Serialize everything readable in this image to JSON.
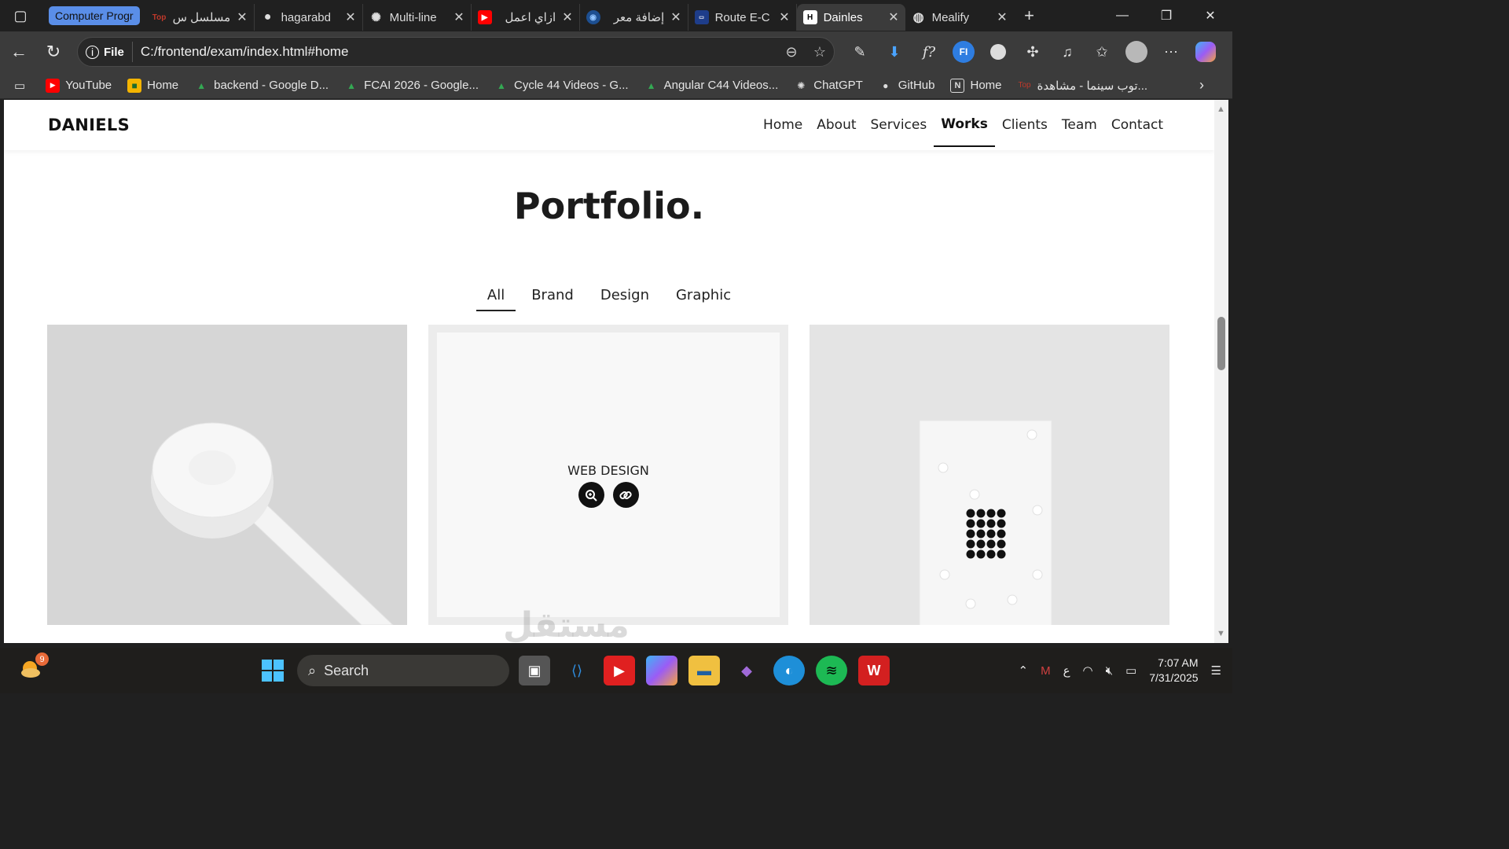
{
  "browser": {
    "tab_group_label": "Computer Progr",
    "tabs": [
      {
        "label": "مسلسل س",
        "favicon": "top-cinema-icon",
        "active": false
      },
      {
        "label": "hagarabd",
        "favicon": "github-icon",
        "active": false
      },
      {
        "label": "Multi-line",
        "favicon": "chatgpt-icon",
        "active": false
      },
      {
        "label": "ازاي اعمل",
        "favicon": "youtube-icon",
        "active": false
      },
      {
        "label": "إضافة معر",
        "favicon": "mostaql-icon",
        "active": false
      },
      {
        "label": "Route E-C",
        "favicon": "route-icon",
        "active": false
      },
      {
        "label": "Dainles",
        "favicon": "dainles-icon",
        "active": true
      },
      {
        "label": "Mealify",
        "favicon": "globe-icon",
        "active": false
      }
    ],
    "address": {
      "scheme_label": "File",
      "url": "C:/frontend/exam/index.html#home"
    },
    "bookmarks": [
      {
        "label": "YouTube",
        "icon": "youtube-icon",
        "color": "#ff0000"
      },
      {
        "label": "Home",
        "icon": "classroom-icon",
        "color": "#f4b400"
      },
      {
        "label": "backend - Google D...",
        "icon": "drive-icon",
        "color": "#34a853"
      },
      {
        "label": "FCAI 2026 - Google...",
        "icon": "drive-icon",
        "color": "#34a853"
      },
      {
        "label": "Cycle 44 Videos - G...",
        "icon": "drive-icon",
        "color": "#34a853"
      },
      {
        "label": "Angular C44 Videos...",
        "icon": "drive-icon",
        "color": "#34a853"
      },
      {
        "label": "ChatGPT",
        "icon": "chatgpt-icon",
        "color": "#e6e6e6"
      },
      {
        "label": "GitHub",
        "icon": "github-icon",
        "color": "#e6e6e6"
      },
      {
        "label": "Home",
        "icon": "notion-icon",
        "color": "#e6e6e6"
      },
      {
        "label": "توب سينما - مشاهدة...",
        "icon": "top-cinema-icon",
        "color": "#c0392b"
      }
    ]
  },
  "site": {
    "brand": "DANIELS",
    "nav": [
      {
        "label": "Home",
        "active": false
      },
      {
        "label": "About",
        "active": false
      },
      {
        "label": "Services",
        "active": false
      },
      {
        "label": "Works",
        "active": true
      },
      {
        "label": "Clients",
        "active": false
      },
      {
        "label": "Team",
        "active": false
      },
      {
        "label": "Contact",
        "active": false
      }
    ],
    "portfolio": {
      "title": "Portfolio.",
      "filters": [
        {
          "label": "All",
          "active": true
        },
        {
          "label": "Brand",
          "active": false
        },
        {
          "label": "Design",
          "active": false
        },
        {
          "label": "Graphic",
          "active": false
        }
      ],
      "hover_label": "WEB DESIGN"
    }
  },
  "watermark": "مستقل",
  "taskbar": {
    "weather_badge": "9",
    "search_placeholder": "Search",
    "time": "7:07 AM",
    "date": "7/31/2025",
    "lang": "ع"
  },
  "colors": {
    "accent": "#5a8ee8",
    "page_bg": "#ffffff",
    "text_dark": "#111111"
  }
}
